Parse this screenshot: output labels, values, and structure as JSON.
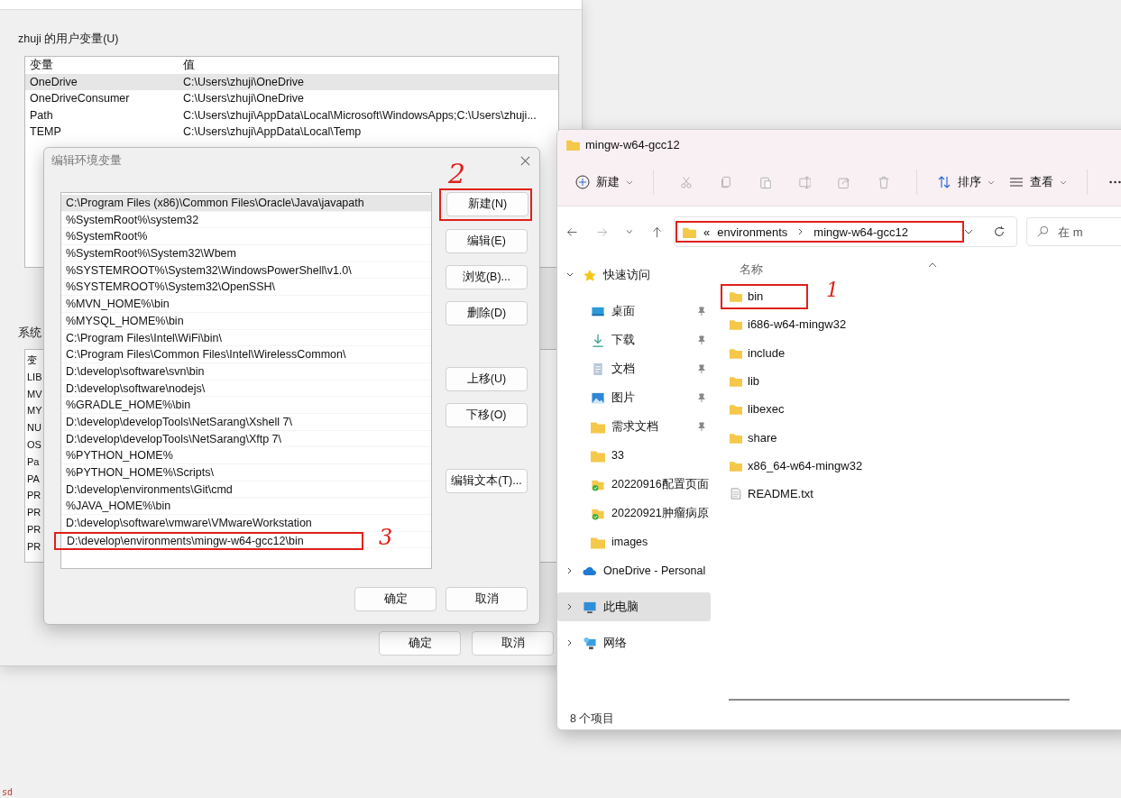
{
  "env_window": {
    "user_vars_label": "zhuji 的用户变量(U)",
    "user_vars": {
      "columns": [
        "变量",
        "值"
      ],
      "rows": [
        {
          "name": "OneDrive",
          "value": "C:\\Users\\zhuji\\OneDrive",
          "selected": true
        },
        {
          "name": "OneDriveConsumer",
          "value": "C:\\Users\\zhuji\\OneDrive",
          "selected": false
        },
        {
          "name": "Path",
          "value": "C:\\Users\\zhuji\\AppData\\Local\\Microsoft\\WindowsApps;C:\\Users\\zhuji...",
          "selected": false
        },
        {
          "name": "TEMP",
          "value": "C:\\Users\\zhuji\\AppData\\Local\\Temp",
          "selected": false
        }
      ]
    },
    "system_vars_label": "系统",
    "system_vars": [
      "变",
      "LIB",
      "MV",
      "MY",
      "NU",
      "OS",
      "Pa",
      "PA",
      "PR",
      "PR",
      "PR",
      "PR"
    ],
    "buttons": [
      "确定",
      "取消"
    ]
  },
  "edit_dialog": {
    "title": "编辑环境变量",
    "entries": [
      {
        "text": "C:\\Program Files (x86)\\Common Files\\Oracle\\Java\\javapath",
        "selected": true
      },
      {
        "text": "%SystemRoot%\\system32",
        "selected": false
      },
      {
        "text": "%SystemRoot%",
        "selected": false
      },
      {
        "text": "%SystemRoot%\\System32\\Wbem",
        "selected": false
      },
      {
        "text": "%SYSTEMROOT%\\System32\\WindowsPowerShell\\v1.0\\",
        "selected": false
      },
      {
        "text": "%SYSTEMROOT%\\System32\\OpenSSH\\",
        "selected": false
      },
      {
        "text": "%MVN_HOME%\\bin",
        "selected": false
      },
      {
        "text": "%MYSQL_HOME%\\bin",
        "selected": false
      },
      {
        "text": "C:\\Program Files\\Intel\\WiFi\\bin\\",
        "selected": false
      },
      {
        "text": "C:\\Program Files\\Common Files\\Intel\\WirelessCommon\\",
        "selected": false
      },
      {
        "text": "D:\\develop\\software\\svn\\bin",
        "selected": false
      },
      {
        "text": "D:\\develop\\software\\nodejs\\",
        "selected": false
      },
      {
        "text": "%GRADLE_HOME%\\bin",
        "selected": false
      },
      {
        "text": "D:\\develop\\developTools\\NetSarang\\Xshell 7\\",
        "selected": false
      },
      {
        "text": "D:\\develop\\developTools\\NetSarang\\Xftp 7\\",
        "selected": false
      },
      {
        "text": "%PYTHON_HOME%",
        "selected": false
      },
      {
        "text": "%PYTHON_HOME%\\Scripts\\",
        "selected": false
      },
      {
        "text": "D:\\develop\\environments\\Git\\cmd",
        "selected": false
      },
      {
        "text": "%JAVA_HOME%\\bin",
        "selected": false
      },
      {
        "text": "D:\\develop\\software\\vmware\\VMwareWorkstation",
        "selected": false
      },
      {
        "text": "D:\\develop\\environments\\mingw-w64-gcc12\\bin",
        "selected": false,
        "annotation": "3"
      }
    ],
    "side_buttons": [
      {
        "label": "新建(N)",
        "annotation": "2"
      },
      {
        "label": "编辑(E)"
      },
      {
        "label": "浏览(B)..."
      },
      {
        "label": "删除(D)"
      },
      {
        "label": "上移(U)"
      },
      {
        "label": "下移(O)"
      },
      {
        "label": "编辑文本(T)..."
      }
    ],
    "buttons": [
      "确定",
      "取消"
    ]
  },
  "explorer": {
    "title": "mingw-w64-gcc12",
    "toolbar": {
      "new": "新建",
      "sort": "排序",
      "view": "查看"
    },
    "address": {
      "overflow": "«",
      "crumbs": [
        "environments",
        "mingw-w64-gcc12"
      ],
      "highlighted": true
    },
    "search": {
      "placeholder": "在 m"
    },
    "nav": [
      {
        "label": "快速访问",
        "kind": "star",
        "expanded": true,
        "selected": false,
        "children": [
          {
            "label": "桌面",
            "kind": "desktop",
            "pinned": true,
            "selected": false
          },
          {
            "label": "下载",
            "kind": "download",
            "pinned": true,
            "selected": false
          },
          {
            "label": "文档",
            "kind": "document",
            "pinned": true,
            "selected": false
          },
          {
            "label": "图片",
            "kind": "picture",
            "pinned": true,
            "selected": false
          },
          {
            "label": "需求文档",
            "kind": "folder",
            "pinned": true,
            "selected": false
          },
          {
            "label": "33",
            "kind": "folder",
            "pinned": false,
            "selected": false
          },
          {
            "label": "20220916配置页面",
            "kind": "synced",
            "pinned": false,
            "selected": false
          },
          {
            "label": "20220921肿瘤病原",
            "kind": "synced",
            "pinned": false,
            "selected": false
          },
          {
            "label": "images",
            "kind": "folder",
            "pinned": false,
            "selected": false
          }
        ]
      },
      {
        "label": "OneDrive - Personal",
        "kind": "cloud",
        "expanded": false,
        "selected": false
      },
      {
        "label": "此电脑",
        "kind": "computer",
        "expanded": false,
        "selected": true
      },
      {
        "label": "网络",
        "kind": "network",
        "expanded": false,
        "selected": false
      }
    ],
    "column": "名称",
    "files": [
      {
        "name": "bin",
        "kind": "folder",
        "annotation": "1"
      },
      {
        "name": "i686-w64-mingw32",
        "kind": "folder"
      },
      {
        "name": "include",
        "kind": "folder"
      },
      {
        "name": "lib",
        "kind": "folder"
      },
      {
        "name": "libexec",
        "kind": "folder"
      },
      {
        "name": "share",
        "kind": "folder"
      },
      {
        "name": "x86_64-w64-mingw32",
        "kind": "folder"
      },
      {
        "name": "README.txt",
        "kind": "file"
      }
    ],
    "status": "8 个项目"
  },
  "corner_text": "sd"
}
